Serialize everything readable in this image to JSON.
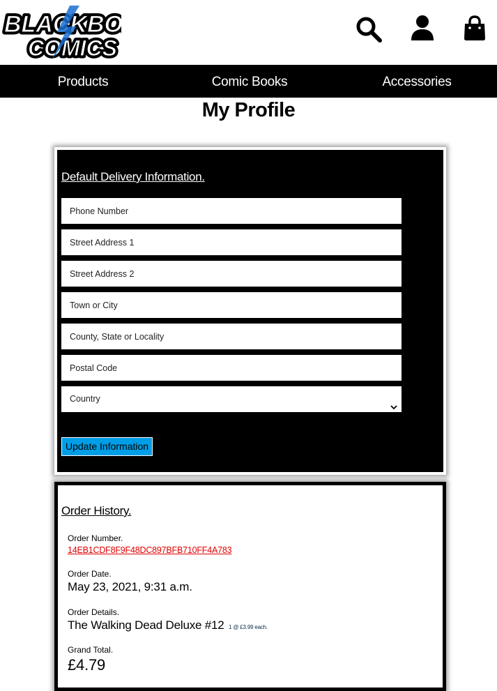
{
  "brand": {
    "logo_line1": "BLACKBOLT",
    "logo_line2": "COMICS",
    "colors": {
      "black": "#000000",
      "accent_blue": "#1a6fd0",
      "button_blue": "#009ee6",
      "link_red": "#e00000"
    }
  },
  "header": {
    "icons": [
      "search-icon",
      "user-icon",
      "shopping-bag-icon"
    ]
  },
  "nav": {
    "items": [
      {
        "label": "Products"
      },
      {
        "label": "Comic Books"
      },
      {
        "label": "Accessories"
      }
    ]
  },
  "page": {
    "title": "My Profile"
  },
  "delivery": {
    "heading": "Default Delivery Information.",
    "fields": [
      {
        "placeholder": "Phone Number",
        "value": ""
      },
      {
        "placeholder": "Street Address 1",
        "value": ""
      },
      {
        "placeholder": "Street Address 2",
        "value": ""
      },
      {
        "placeholder": "Town or City",
        "value": ""
      },
      {
        "placeholder": "County, State or Locality",
        "value": ""
      },
      {
        "placeholder": "Postal Code",
        "value": ""
      }
    ],
    "country_select": {
      "selected": "Country"
    },
    "update_button": "Update Information"
  },
  "orders": {
    "heading": "Order History.",
    "order_number_label": "Order Number.",
    "order_number": "14EB1CDF8F9F48DC897BFB710FF4A783",
    "order_date_label": "Order Date.",
    "order_date": "May 23, 2021, 9:31 a.m.",
    "order_details_label": "Order Details.",
    "item_name": "The Walking Dead Deluxe #12",
    "item_qty_price": "1 @ £3.99 each.",
    "grand_total_label": "Grand Total.",
    "grand_total": "£4.79"
  }
}
